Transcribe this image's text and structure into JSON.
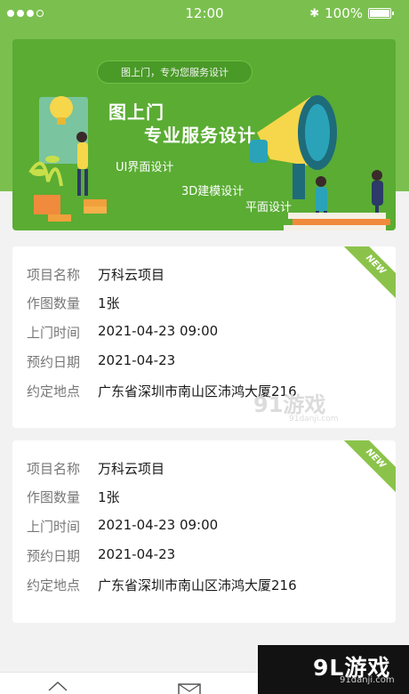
{
  "status_bar": {
    "time": "12:00",
    "battery": "100%",
    "icons": [
      "signal-dots-icon",
      "bluetooth-icon",
      "battery-icon"
    ]
  },
  "banner": {
    "pill_text": "图上门，专为您服务设计",
    "title_line1": "图上门",
    "title_line2": "专业服务设计",
    "label_ui": "UI界面设计",
    "label_3d": "3D建模设计",
    "label_flat": "平面设计"
  },
  "cards": [
    {
      "ribbon": "NEW",
      "fields": [
        {
          "label": "项目名称",
          "value": "万科云项目"
        },
        {
          "label": "作图数量",
          "value": "1张"
        },
        {
          "label": "上门时间",
          "value": "2021-04-23  09:00"
        },
        {
          "label": "预约日期",
          "value": "2021-04-23"
        },
        {
          "label": "约定地点",
          "value": "广东省深圳市南山区沛鸿大厦216"
        }
      ]
    },
    {
      "ribbon": "NEW",
      "fields": [
        {
          "label": "项目名称",
          "value": "万科云项目"
        },
        {
          "label": "作图数量",
          "value": "1张"
        },
        {
          "label": "上门时间",
          "value": "2021-04-23  09:00"
        },
        {
          "label": "预约日期",
          "value": "2021-04-23"
        },
        {
          "label": "约定地点",
          "value": "广东省深圳市南山区沛鸿大厦216"
        }
      ]
    }
  ],
  "watermark": {
    "mid_text": "91游戏",
    "mid_url": "91danji.com",
    "corner_text": "9L游戏",
    "corner_url": "91danji.com"
  },
  "colors": {
    "brand_green": "#7bc04f",
    "banner_green": "#5aac33",
    "ribbon_green": "#8bc34a"
  }
}
